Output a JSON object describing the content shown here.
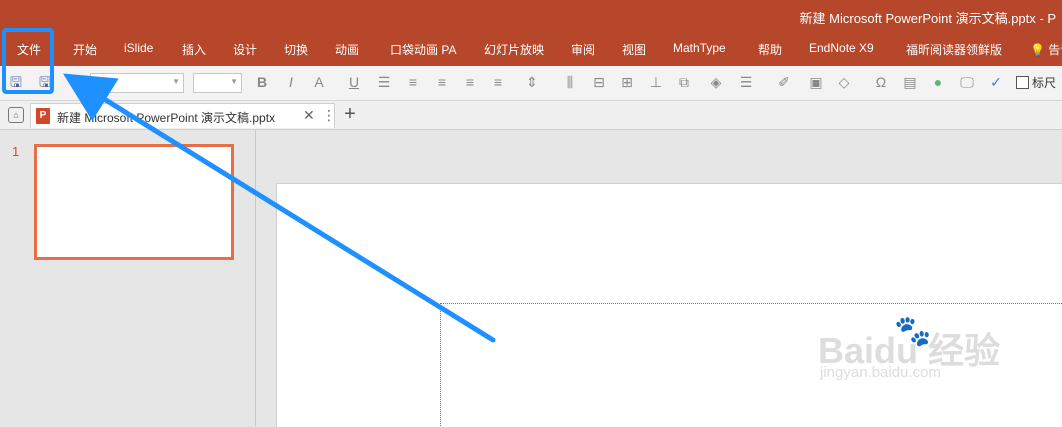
{
  "window": {
    "title": "新建 Microsoft PowerPoint 演示文稿.pptx  -  P"
  },
  "menu": {
    "items": [
      "文件",
      "开始",
      "iSlide",
      "插入",
      "设计",
      "切换",
      "动画",
      "口袋动画 PA",
      "幻灯片放映",
      "审阅",
      "视图",
      "MathType",
      "帮助",
      "EndNote X9",
      "福昕阅读器领鲜版"
    ],
    "tell_me": "告诉"
  },
  "toolbar": {
    "ruler_label": "标尺"
  },
  "tabs": {
    "doc_title": "新建 Microsoft PowerPoint 演示文稿.pptx",
    "ppt_badge": "P"
  },
  "slides": {
    "number": "1"
  },
  "watermark": {
    "main": "Bai",
    "brand": "经验",
    "sub": "jingyan.baidu.com"
  },
  "colors": {
    "accent": "#b7472a",
    "highlight": "#1e90ff",
    "thumb_border": "#e86e4a"
  }
}
